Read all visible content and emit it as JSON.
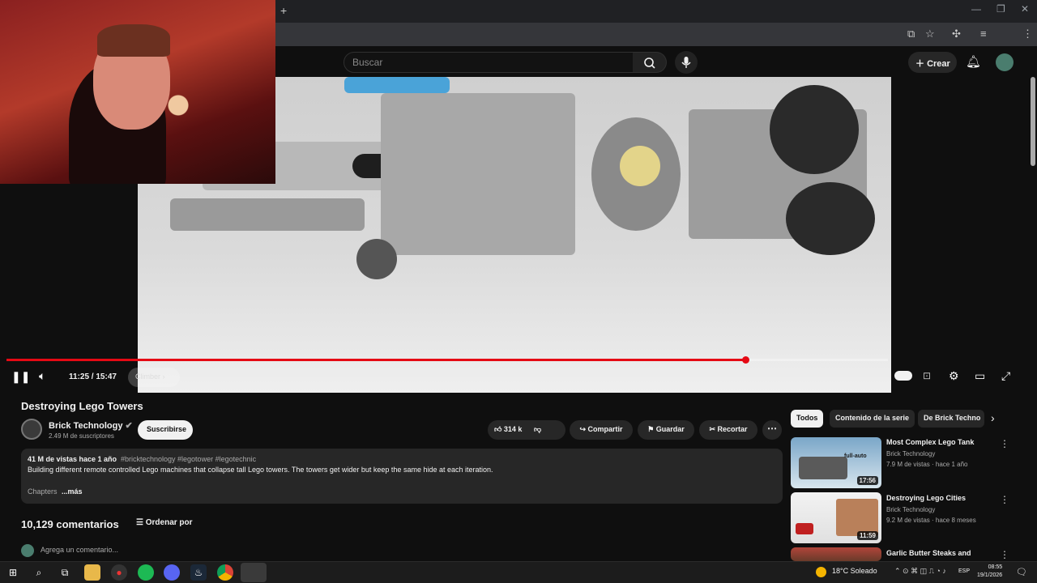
{
  "browser": {
    "new_tab_glyph": "+",
    "window_controls": [
      "—",
      "❐",
      "✕"
    ]
  },
  "header": {
    "search_placeholder": "Buscar",
    "create_label": "Crear"
  },
  "player": {
    "time": "11:25 / 15:47",
    "chapter": "Climber",
    "progress": 0.838
  },
  "video": {
    "title": "Destroying Lego Towers",
    "channel": "Brick Technology",
    "subscribers": "2.49 M de suscriptores",
    "subscribe_label": "Suscribirse",
    "likes": "314 k",
    "share_label": "Compartir",
    "save_label": "Guardar",
    "clip_label": "Recortar"
  },
  "description": {
    "meta": "41 M de vistas  hace 1 año",
    "tags": "#bricktechnology #legotower #legotechnic",
    "text": "Building different remote controlled Lego machines that collapse tall Lego towers. The towers get wider but keep the same hide at each iteration.",
    "chapters_label": "Chapters",
    "more_label": "...más"
  },
  "comments": {
    "count": "10,129 comentarios",
    "sort_label": "Ordenar por",
    "input_placeholder": "Agrega un comentario..."
  },
  "sidebar": {
    "chips": [
      "Todos",
      "Contenido de la serie",
      "De Brick Techno"
    ],
    "items": [
      {
        "title": "Most Complex Lego Tank",
        "channel": "Brick Technology",
        "meta": "7.9 M de vistas · hace 1 año",
        "duration": "17:56",
        "badge": "full-auto"
      },
      {
        "title": "Destroying Lego Cities",
        "channel": "Brick Technology",
        "meta": "9.2 M de vistas · hace 8 meses",
        "duration": "11:59"
      },
      {
        "title": "Garlic Butter Steaks and",
        "channel": "",
        "meta": "",
        "duration": ""
      }
    ]
  },
  "taskbar": {
    "weather": "18°C  Soleado",
    "lang": "ESP",
    "time": "08:55",
    "date": "19/1/2026"
  }
}
